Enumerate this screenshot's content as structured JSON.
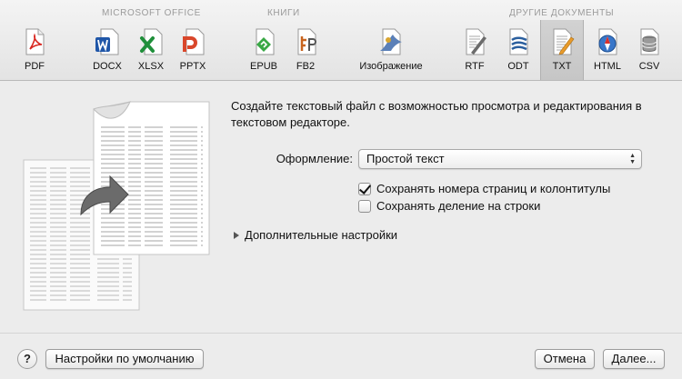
{
  "toolbar": {
    "groups": {
      "office": "MICROSOFT OFFICE",
      "books": "КНИГИ",
      "other": "ДРУГИЕ ДОКУМЕНТЫ"
    },
    "items": [
      {
        "label": "PDF",
        "icon": "pdf-icon"
      },
      {
        "label": "DOCX",
        "icon": "docx-icon"
      },
      {
        "label": "XLSX",
        "icon": "xlsx-icon"
      },
      {
        "label": "PPTX",
        "icon": "pptx-icon"
      },
      {
        "label": "EPUB",
        "icon": "epub-icon"
      },
      {
        "label": "FB2",
        "icon": "fb2-icon"
      },
      {
        "label": "Изображение",
        "icon": "image-icon"
      },
      {
        "label": "RTF",
        "icon": "rtf-icon"
      },
      {
        "label": "ODT",
        "icon": "odt-icon"
      },
      {
        "label": "TXT",
        "icon": "txt-icon",
        "selected": true
      },
      {
        "label": "HTML",
        "icon": "html-icon"
      },
      {
        "label": "CSV",
        "icon": "csv-icon"
      }
    ]
  },
  "main": {
    "description": "Создайте текстовый файл с возможностью просмотра и редактирования в текстовом редакторе.",
    "format_label": "Оформление:",
    "format_value": "Простой текст",
    "checkbox_page_numbers": {
      "label": "Сохранять номера страниц и колонтитулы",
      "checked": true
    },
    "checkbox_line_breaks": {
      "label": "Сохранять деление на строки",
      "checked": false
    },
    "advanced": "Дополнительные настройки"
  },
  "footer": {
    "help": "?",
    "defaults": "Настройки по умолчанию",
    "cancel": "Отмена",
    "next": "Далее..."
  },
  "colors": {
    "pdf": "#d8261f",
    "docx": "#1f56a8",
    "xlsx": "#1f8f3a",
    "pptx": "#d9472b",
    "epub": "#39a845",
    "fb2": "#c8641e",
    "accent_blue": "#3876c9"
  }
}
